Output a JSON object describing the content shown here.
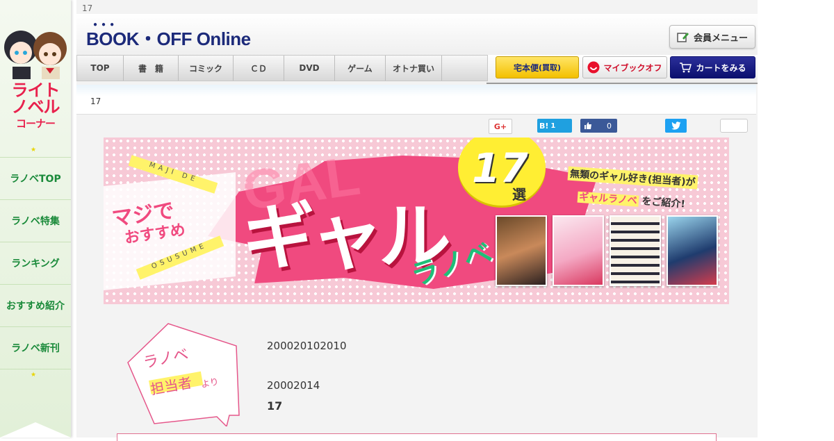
{
  "top_counter": "17",
  "brand": {
    "name": "BOOK・OFF Online"
  },
  "header": {
    "member_menu": "会員メニュー",
    "takuhai": "宅本便",
    "takuhai_sub": "(買取)",
    "mybookoff": "マイブックオフ",
    "cart": "カートをみる"
  },
  "nav": [
    {
      "label": "TOP"
    },
    {
      "label": "書　籍"
    },
    {
      "label": "コミック"
    },
    {
      "label": "ＣＤ"
    },
    {
      "label": "DVD"
    },
    {
      "label": "ゲーム"
    },
    {
      "label": "オトナ買い"
    }
  ],
  "sidebar": {
    "logo_line1": "ライト",
    "logo_line2": "ノベル",
    "logo_line3": "コーナー",
    "star": "★",
    "items": [
      {
        "label": "ラノベTOP"
      },
      {
        "label": "ラノベ特集"
      },
      {
        "label": "ランキング"
      },
      {
        "label": "おすすめ紹介"
      },
      {
        "label": "ラノベ新刊"
      }
    ]
  },
  "breadcrumb": "17",
  "share": {
    "gplus": "G+",
    "hatena": "B!",
    "hatena_count": "1",
    "fb_count": "0"
  },
  "banner": {
    "maji_de": "MAJI DE",
    "osusume_en": "OSUSUME",
    "maji": "マジで",
    "osusume": "おすすめ",
    "gal": "GAL",
    "gyaru": "ギャル",
    "ranobe": "ラノベ",
    "count": "17",
    "sen": "選",
    "tagline1": "無類のギャル好き(担当者)が",
    "tagline2_hl": "ギャルラノベ",
    "tagline2_rest": "をご紹介!"
  },
  "intro": {
    "badge_line1": "ラノベ",
    "badge_line2": "担当者",
    "badge_yori": "より",
    "line1": "200020102010",
    "line2": "20002014",
    "line3": "17"
  },
  "colors": {
    "brand_navy": "#1c2a7a",
    "sidebar_green": "#1a8a3a",
    "accent_pink": "#f04a7f",
    "highlight_yellow": "#fff36a"
  }
}
